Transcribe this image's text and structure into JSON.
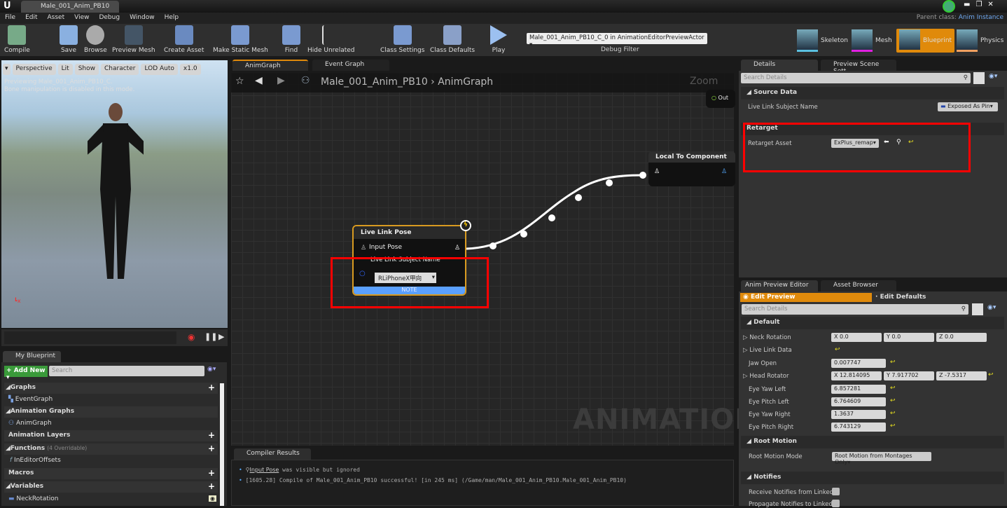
{
  "window": {
    "tab_title": "Male_001_Anim_PB10",
    "parent_class_label": "Parent class:",
    "parent_class_value": "Anim Instance",
    "buttons": [
      "minimize",
      "restore",
      "close"
    ]
  },
  "menu": [
    "File",
    "Edit",
    "Asset",
    "View",
    "Debug",
    "Window",
    "Help"
  ],
  "toolbar": {
    "items": [
      "Compile",
      "Save",
      "Browse",
      "Preview Mesh",
      "Create Asset",
      "Make Static Mesh",
      "Find",
      "Hide Unrelated",
      "Class Settings",
      "Class Defaults",
      "Play"
    ],
    "debug_select": "Male_001_Anim_PB10_C_0 in AnimationEditorPreviewActor",
    "debug_label": "Debug Filter",
    "modes": [
      "Skeleton",
      "Mesh",
      "Blueprint",
      "Physics"
    ],
    "active_mode": "Blueprint",
    "accent": "#e08a0b"
  },
  "viewport": {
    "buttons": [
      "Perspective",
      "Lit",
      "Show",
      "Character",
      "LOD Auto",
      "x1.0"
    ],
    "line1": "Previewing Male_001_Anim_PB10_C.",
    "line2": "Bone manipulation is disabled in this mode."
  },
  "my_blueprint": {
    "tab": "My Blueprint",
    "add_new": "Add New",
    "search_placeholder": "Search",
    "rows": [
      {
        "label": "Graphs",
        "head": true
      },
      {
        "label": "EventGraph"
      },
      {
        "label": "Animation Graphs",
        "head": true
      },
      {
        "label": "AnimGraph"
      },
      {
        "label": "Animation Layers",
        "head": true
      },
      {
        "label": "Functions",
        "note": "(4 Overridable)",
        "head": true
      },
      {
        "label": "InEditorOffsets"
      },
      {
        "label": "Macros",
        "head": true
      },
      {
        "label": "Variables",
        "head": true
      },
      {
        "label": "NeckRotation"
      }
    ]
  },
  "graph": {
    "tabs": [
      "AnimGraph",
      "Event Graph"
    ],
    "breadcrumb": [
      "Male_001_Anim_PB10",
      "AnimGraph"
    ],
    "zoom": "Zoom",
    "out_pin": "Out",
    "watermark": "ANIMATION",
    "live_link_node": {
      "title": "Live Link Pose",
      "input": "Input Pose",
      "param": "Live Link Subject Name",
      "value": "RLiPhoneX甲向",
      "footer": "NOTE"
    },
    "ltc_node": {
      "title": "Local To Component"
    }
  },
  "compiler": {
    "tab": "Compiler Results",
    "lines": [
      {
        "link": "Input Pose",
        "text": "was visible but ignored"
      },
      {
        "text": "[1605.28] Compile of Male_001_Anim_PB10 successful! [in 245 ms] (/Game/man/Male_001_Anim_PB10.Male_001_Anim_PB10)"
      }
    ]
  },
  "details": {
    "tabs": [
      "Details",
      "Preview Scene Sett"
    ],
    "search_placeholder": "Search Details",
    "source_data": "Source Data",
    "subject_label": "Live Link Subject Name",
    "subject_value": "Exposed As Pin",
    "retarget": "Retarget",
    "retarget_label": "Retarget Asset",
    "retarget_value": "ExPlus_remap"
  },
  "anim_preview": {
    "tabs": [
      "Anim Preview Editor",
      "Asset Browser"
    ],
    "edit_preview": "Edit Preview",
    "edit_defaults": "Edit Defaults",
    "search_placeholder": "Search Details",
    "default": "Default",
    "neck": {
      "label": "Neck Rotation",
      "x": "X  0.0",
      "y": "Y  0.0",
      "z": "Z  0.0"
    },
    "live_link_data": "Live Link Data",
    "jaw": {
      "label": "Jaw Open",
      "value": "0.007747"
    },
    "head": {
      "label": "Head Rotator",
      "x": "X  12.814095",
      "y": "Y  7.917702",
      "z": "Z  -7.5317"
    },
    "eyes": [
      {
        "label": "Eye Yaw Left",
        "value": "6.857281"
      },
      {
        "label": "Eye Pitch Left",
        "value": "6.764609"
      },
      {
        "label": "Eye Yaw Right",
        "value": "1.3637"
      },
      {
        "label": "Eye Pitch Right",
        "value": "6.743129"
      }
    ],
    "root_motion": "Root Motion",
    "root_mode_label": "Root Motion Mode",
    "root_mode_value": "Root Motion from Montages Only",
    "notifies": "Notifies",
    "notify1": "Receive Notifies from Linked I",
    "notify2": "Propagate Notifies to Linked In"
  }
}
